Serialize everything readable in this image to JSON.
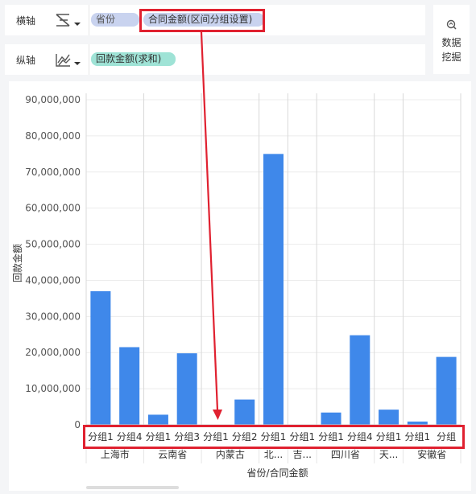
{
  "x_axis": {
    "label": "横轴",
    "icon": "bar-chart-type-icon",
    "fields": [
      "省份",
      "合同金额(区间分组设置)"
    ]
  },
  "y_axis": {
    "label": "纵轴",
    "icon": "line-chart-type-icon",
    "fields": [
      "回款金额(求和)"
    ]
  },
  "side_button": {
    "icon": "data-mining-icon",
    "line1": "数据",
    "line2": "挖掘"
  },
  "colors": {
    "bar": "#3f88ea",
    "pill_blue": "#c9d3ef",
    "pill_teal": "#9fe3d6",
    "highlight": "#e02130"
  },
  "chart_data": {
    "type": "bar",
    "ylabel": "回款金额",
    "xlabel": "省份/合同金额",
    "ylim": [
      0,
      90000000
    ],
    "yticks": [
      "0",
      "10,000,000",
      "20,000,000",
      "30,000,000",
      "40,000,000",
      "50,000,000",
      "60,000,000",
      "70,000,000",
      "80,000,000",
      "90,000,000"
    ],
    "categories": [
      "分组1",
      "分组4",
      "分组1",
      "分组3",
      "分组1",
      "分组2",
      "分组1",
      "分组1",
      "分组1",
      "分组4",
      "分组1",
      "分组1",
      "分组"
    ],
    "groups": [
      "上海市",
      "云南省",
      "内蒙古",
      "北...",
      "吉...",
      "四川省",
      "天...",
      "安徽省"
    ],
    "group_spans": [
      2,
      2,
      2,
      1,
      1,
      2,
      1,
      2
    ],
    "values": [
      37000000,
      21500000,
      2800000,
      19800000,
      0,
      7000000,
      75000000,
      0,
      3400000,
      24800000,
      4200000,
      900000,
      18800000
    ]
  }
}
